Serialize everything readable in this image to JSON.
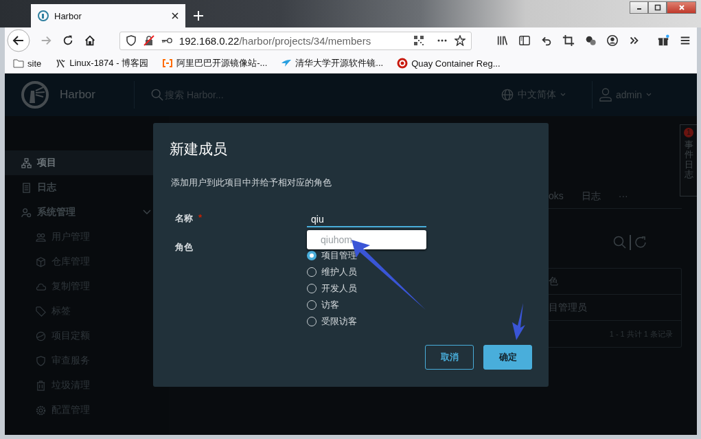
{
  "browser": {
    "tab_title": "Harbor",
    "url_host": "192.168.0.22",
    "url_path": "/harbor/projects/34/members",
    "bookmarks": [
      {
        "label": "site"
      },
      {
        "label": "Linux-1874 - 博客园"
      },
      {
        "label": "阿里巴巴开源镜像站-..."
      },
      {
        "label": "清华大学开源软件镜..."
      },
      {
        "label": "Quay Container Reg..."
      }
    ]
  },
  "header": {
    "brand": "Harbor",
    "search_placeholder": "搜索 Harbor...",
    "language": "中文简体",
    "user": "admin"
  },
  "sidebar": {
    "items": [
      {
        "label": "项目",
        "selected": true
      },
      {
        "label": "日志",
        "selected": false
      },
      {
        "label": "系统管理",
        "selected": false,
        "expanded": true,
        "children": [
          {
            "label": "用户管理",
            "selected": false
          },
          {
            "label": "仓库管理",
            "selected": false
          },
          {
            "label": "复制管理",
            "selected": false
          },
          {
            "label": "标签",
            "selected": false
          },
          {
            "label": "项目定额",
            "selected": false
          },
          {
            "label": "审查服务",
            "selected": false
          },
          {
            "label": "垃圾清理",
            "selected": false
          },
          {
            "label": "配置管理",
            "selected": false
          }
        ]
      }
    ]
  },
  "page_behind": {
    "tabs": [
      "oks",
      "日志",
      "···"
    ],
    "table": {
      "header": "色",
      "rows": [
        "目管理员"
      ],
      "footer": "1 - 1 共计 1 条记录"
    }
  },
  "event_log": {
    "label": "事件日志",
    "badge": "1"
  },
  "dialog": {
    "title": "新建成员",
    "description": "添加用户到此项目中并给予相对应的角色",
    "name_field": {
      "label": "名称",
      "required_mark": "*",
      "value": "qiu",
      "suggestions": [
        "qiuhom"
      ]
    },
    "role_field": {
      "label": "角色",
      "options": [
        {
          "label": "项目管理",
          "selected": true
        },
        {
          "label": "维护人员",
          "selected": false
        },
        {
          "label": "开发人员",
          "selected": false
        },
        {
          "label": "访客",
          "selected": false
        },
        {
          "label": "受限访客",
          "selected": false
        }
      ]
    },
    "buttons": [
      {
        "label": "取消",
        "kind": "secondary"
      },
      {
        "label": "确定",
        "kind": "primary"
      }
    ]
  }
}
